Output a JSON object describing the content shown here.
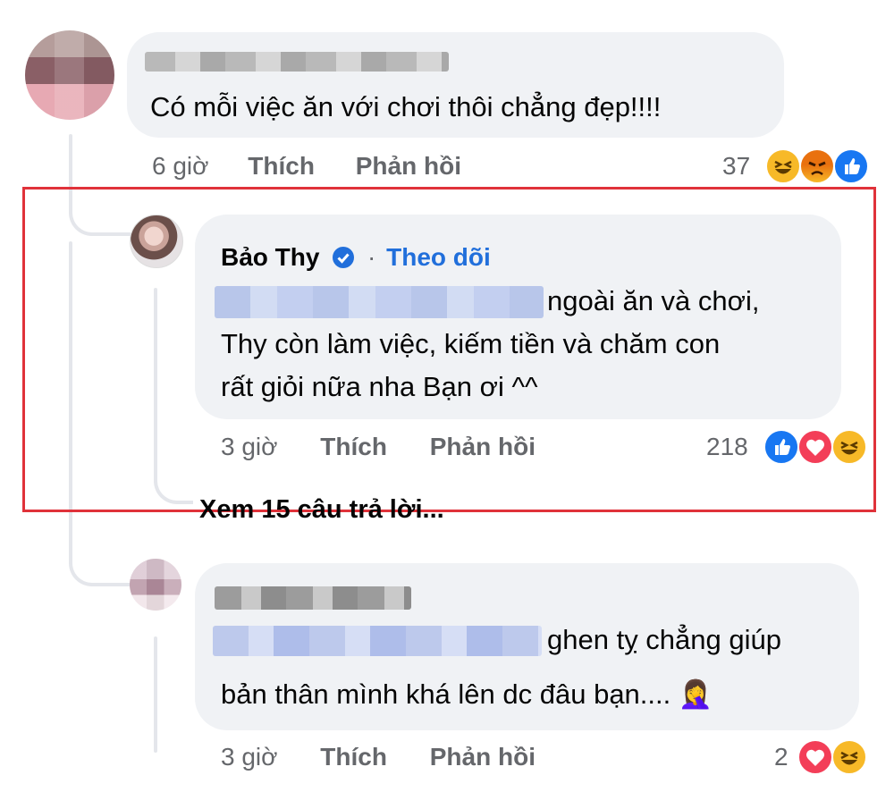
{
  "comment1": {
    "text": "Có mỗi việc ăn với chơi thôi chẳng đẹp!!!!",
    "time": "6 giờ",
    "like_label": "Thích",
    "reply_label": "Phản hồi",
    "reaction_count": "37",
    "reactions": [
      "haha",
      "angry",
      "like"
    ]
  },
  "reply1": {
    "author": "Bảo Thy",
    "verified_icon": "verified-badge-icon",
    "separator": "·",
    "follow_label": "Theo dõi",
    "text_line1": "ngoài ăn và chơi,",
    "text_line2": "Thy còn làm việc, kiếm tiền và chăm con",
    "text_line3": "rất giỏi nữa nha Bạn ơi ^^",
    "time": "3 giờ",
    "like_label": "Thích",
    "reply_label": "Phản hồi",
    "reaction_count": "218",
    "reactions": [
      "like",
      "love",
      "haha"
    ]
  },
  "view_replies": "Xem 15 câu trả lời...",
  "comment2": {
    "text_line1": "ghen tỵ chẳng giúp",
    "text_line2": "bản thân mình khá lên dc đâu bạn....",
    "emoji": "🤦‍♀️",
    "time": "3 giờ",
    "like_label": "Thích",
    "reply_label": "Phản hồi",
    "reaction_count": "2",
    "reactions": [
      "love",
      "haha"
    ]
  },
  "colors": {
    "highlight_border": "#e0323a",
    "link_blue": "#216fdb",
    "bubble_bg": "#f0f2f5",
    "meta_gray": "#65676b"
  }
}
